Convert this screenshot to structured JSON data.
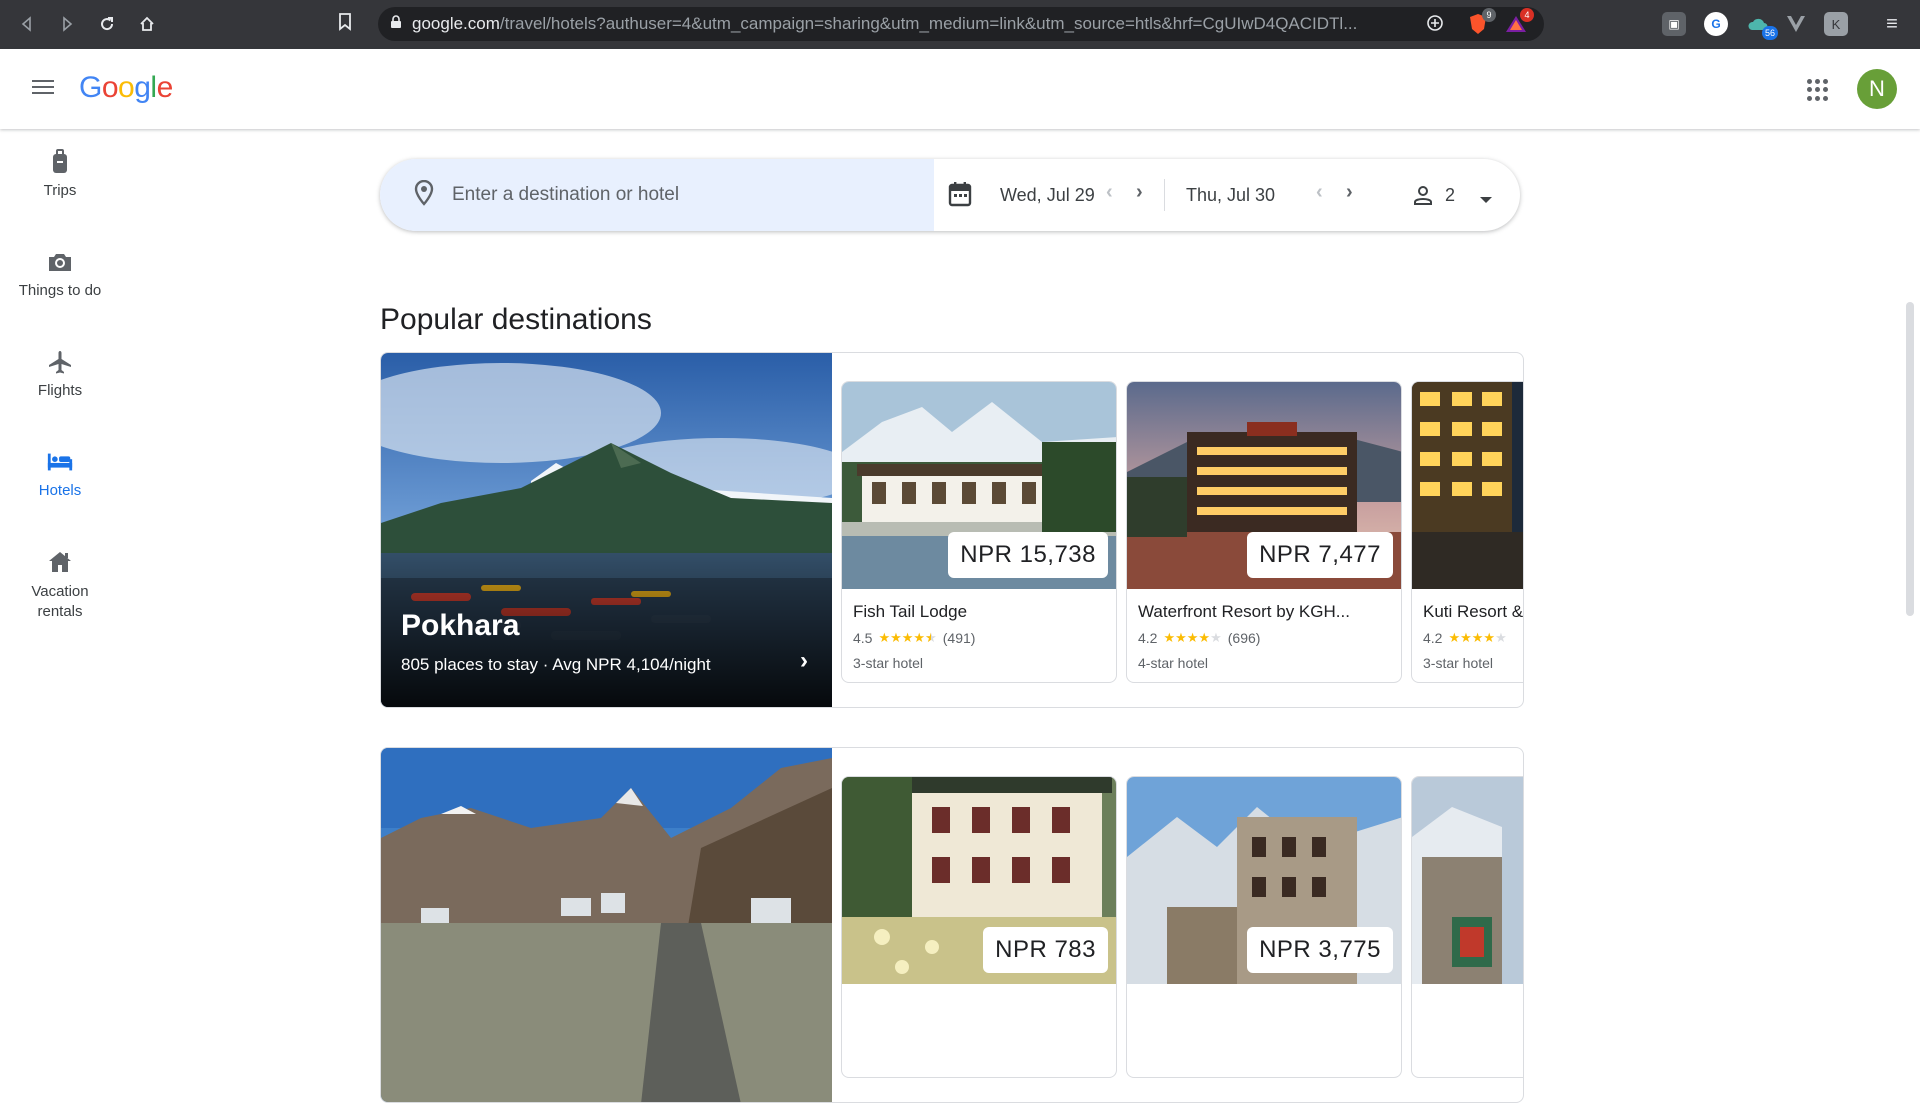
{
  "browser": {
    "url_host": "google.com",
    "url_rest": "/travel/hotels?authuser=4&utm_campaign=sharing&utm_medium=link&utm_source=htls&hrf=CgUIwD4QACIDTl...",
    "ext_badge_1": "9",
    "ext_badge_2": "4",
    "ext_badge_3": "56"
  },
  "header": {
    "logo": "Google",
    "avatar_letter": "N"
  },
  "rail": {
    "trips": "Trips",
    "things": "Things to do",
    "flights": "Flights",
    "hotels": "Hotels",
    "vacation": "Vacation rentals"
  },
  "search": {
    "placeholder": "Enter a destination or hotel",
    "checkin": "Wed, Jul 29",
    "checkout": "Thu, Jul 30",
    "guests": "2"
  },
  "section_title": "Popular destinations",
  "destinations": [
    {
      "name": "Pokhara",
      "summary": "805 places to stay · Avg NPR 4,104/night",
      "hotels": [
        {
          "price": "NPR 15,738",
          "name": "Fish Tail Lodge",
          "rating": "4.5",
          "reviews": "(491)",
          "class": "3-star hotel"
        },
        {
          "price": "NPR 7,477",
          "name": "Waterfront Resort by KGH...",
          "rating": "4.2",
          "reviews": "(696)",
          "class": "4-star hotel"
        },
        {
          "price": "",
          "name": "Kuti Resort &",
          "rating": "4.2",
          "reviews": "",
          "class": "3-star hotel"
        }
      ]
    },
    {
      "name": "",
      "summary": "",
      "hotels": [
        {
          "price": "NPR 783",
          "name": "",
          "rating": "",
          "reviews": "",
          "class": ""
        },
        {
          "price": "NPR 3,775",
          "name": "",
          "rating": "",
          "reviews": "",
          "class": ""
        }
      ]
    }
  ],
  "colors": {
    "accent": "#1a73e8",
    "chrome": "#35363a",
    "star": "#fbbc04",
    "avatar": "#689f38"
  }
}
